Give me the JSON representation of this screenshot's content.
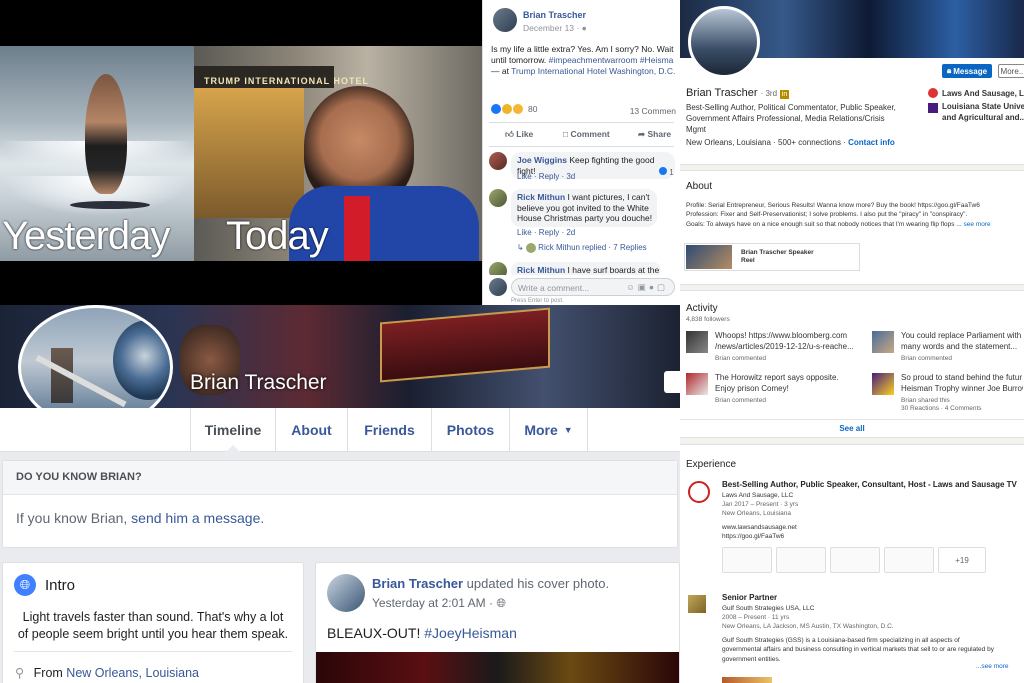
{
  "meme": {
    "left_caption": "Yesterday",
    "right_caption": "Today",
    "hotel_sign": "TRUMP INTERNATIONAL HOTEL"
  },
  "fb_post": {
    "author": "Brian Trascher",
    "date": "December 13 ·",
    "text_line1": "Is my life a little extra? Yes. Am I sorry? No. Wait",
    "text_line2": "until tomorrow.",
    "hashtags": "#impeachmentwarroom #Heisma",
    "location_prefix": "— at ",
    "location": "Trump International Hotel Washington, D.C.",
    "reaction_count": "80",
    "comment_count": "13 Commen",
    "like_label": "Like",
    "comment_label": "Comment",
    "share_label": "Share",
    "comments": [
      {
        "author": "Joe Wiggins",
        "text": "Keep fighting the good fight!",
        "meta": "Like · Reply · 3d",
        "likes": "1"
      },
      {
        "author": "Rick Mithun",
        "text_line1": "I want pictures, I can't",
        "text_line2": "believe you got invited to the White",
        "text_line3": "House Christmas party you douche!",
        "meta": "Like · Reply · 2d"
      },
      {
        "author": "Rick Mithun",
        "text": "I have surf boards at the"
      }
    ],
    "replied": "Rick Mithun replied · 7 Replies",
    "write_placeholder": "Write a comment...",
    "enter_hint": "Press Enter to post."
  },
  "linkedin": {
    "message_button": "Message",
    "more_button": "More...",
    "name": "Brian Trascher",
    "degree": "· 3rd",
    "headline_line1": "Best-Selling Author, Political Commentator, Public Speaker,",
    "headline_line2": "Government Affairs Professional, Media Relations/Crisis",
    "headline_line3": "Mgmt",
    "location": "New Orleans, Louisiana",
    "connections": "· 500+ connections ·",
    "contact_info": "Contact info",
    "company": "Laws And Sausage, LLC",
    "school_line1": "Louisiana State Universi",
    "school_line2": "and Agricultural and...",
    "about_heading": "About",
    "about_line1": "Profile: Serial Entrepreneur, Serious Results! Wanna know more? Buy the book! https://goo.gl/FaaTw6",
    "about_line2": "Profession: Fixer and Self-Preservationist; I solve problems. I also put the \"piracy\" in \"conspiracy\".",
    "about_line3": "Goals: To always have on a nice enough suit so that nobody notices that I'm wearing flip flops ...",
    "see_more": "see more",
    "media_title_line1": "Brian Trascher Speaker",
    "media_title_line2": "Reel",
    "activity_heading": "Activity",
    "followers": "4,838 followers",
    "activity": [
      {
        "line1": "Whoops! https://www.bloomberg.com",
        "line2": "/news/articles/2019-12-12/u-s-reache...",
        "meta": "Brian commented"
      },
      {
        "line1": "You could replace Parliament with",
        "line2": "many words and the statement...",
        "meta": "Brian commented"
      },
      {
        "line1": "The Horowitz report says opposite.",
        "line2": "Enjoy prison Comey!",
        "meta": "Brian commented"
      },
      {
        "line1": "So proud to stand behind the futur",
        "line2": "Heisman Trophy winner Joe Burrow",
        "meta": "Brian shared this",
        "meta2": "30 Reactions · 4 Comments"
      }
    ],
    "see_all": "See all",
    "experience_heading": "Experience",
    "exp1_title": "Best-Selling Author, Public Speaker, Consultant, Host - Laws and Sausage TV",
    "exp1_company": "Laws And Sausage, LLC",
    "exp1_dates": "Jan 2017 – Present · 3 yrs",
    "exp1_location": "New Orleans, Louisiana",
    "exp1_url1": "www.lawsandsausage.net",
    "exp1_url2": "https://goo.gl/FaaTw6",
    "exp1_more": "+19",
    "exp2_title": "Senior Partner",
    "exp2_company": "Gulf South Strategies USA, LLC",
    "exp2_dates": "2008 – Present · 11 yrs",
    "exp2_location": "New Orleans, LA Jackson, MS Austin, TX Washington, D.C.",
    "exp2_desc1": "Gulf South Strategies (GSS) is a Louisiana-based firm specializing in all aspects of",
    "exp2_desc2": "governmental affairs and business consulting in vertical markets that sell to or are regulated by",
    "exp2_desc3": "government entities.",
    "exp2_see_more": "...see more"
  },
  "fb_profile": {
    "name": "Brian Trascher",
    "tabs": [
      "Timeline",
      "About",
      "Friends",
      "Photos",
      "More"
    ],
    "know_heading": "DO YOU KNOW BRIAN?",
    "know_text": "If you know Brian,",
    "know_link": "send him a message",
    "know_period": ".",
    "intro_heading": "Intro",
    "intro_line1": "Light travels faster than sound. That's why a lot",
    "intro_line2": "of people seem bright until you hear them speak.",
    "from_label": "From",
    "from_place": "New Orleans, Louisiana",
    "post_author": "Brian Trascher",
    "post_action": "updated his cover photo.",
    "post_time": "Yesterday at 2:01 AM ·",
    "post_text": "BLEAUX-OUT!",
    "post_hashtag": "#JoeyHeisman"
  },
  "colors": {
    "fb_blue": "#385898",
    "li_blue": "#0a66c2",
    "fb_gray": "#e9ebee"
  }
}
